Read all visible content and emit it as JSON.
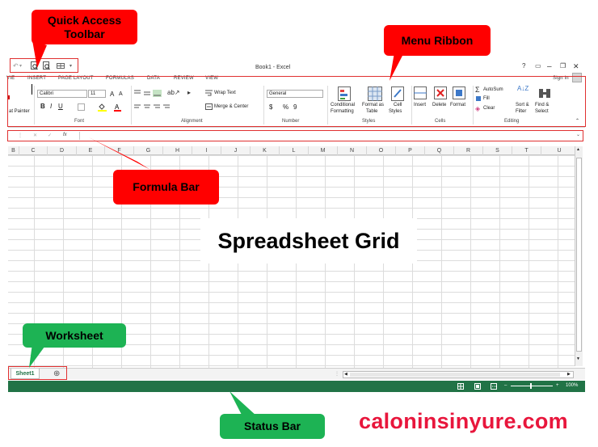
{
  "window": {
    "title": "Book1 - Excel",
    "help": "?",
    "restore_icon": "▭",
    "minimize": "–",
    "maximize": "❐",
    "close": "✕",
    "sign_in": "Sign in"
  },
  "quick_access": {
    "undo": "↶",
    "dropdown": "▾"
  },
  "tabs": [
    "VIE",
    "INSERT",
    "PAGE LAYOUT",
    "FORMULAS",
    "DATA",
    "REVIEW",
    "VIEW"
  ],
  "ribbon": {
    "clipboard": {
      "format_painter": "at Painter"
    },
    "font": {
      "name": "Calibri",
      "size": "11",
      "bold": "B",
      "italic": "I",
      "underline": "U",
      "grow": "A",
      "shrink": "A",
      "label": "Font"
    },
    "alignment": {
      "wrap_text": "Wrap Text",
      "merge_center": "Merge & Center",
      "label": "Alignment"
    },
    "number": {
      "format": "General",
      "currency": "$",
      "percent": "%",
      "comma": "9",
      "label": "Number"
    },
    "styles": {
      "conditional": "Conditional",
      "conditional2": "Formatting",
      "format_as": "Format as",
      "table": "Table",
      "cell": "Cell",
      "cell_styles": "Styles",
      "label": "Styles"
    },
    "cells": {
      "insert": "Insert",
      "delete": "Delete",
      "format": "Format",
      "label": "Cells"
    },
    "editing": {
      "autosum": "AutoSum",
      "fill": "Fill",
      "clear": "Clear",
      "sort": "Sort &",
      "filter": "Filter",
      "find": "Find &",
      "select": "Select",
      "label": "Editing"
    }
  },
  "formula_bar": {
    "dots": "⋮",
    "cancel": "✕",
    "enter": "✓",
    "fx": "fx",
    "expand": "⌄"
  },
  "columns": [
    "B",
    "C",
    "D",
    "E",
    "F",
    "G",
    "H",
    "I",
    "J",
    "K",
    "L",
    "M",
    "N",
    "O",
    "P",
    "Q",
    "R",
    "S",
    "T",
    "U"
  ],
  "sheets": {
    "sheet1": "Sheet1",
    "add": "⊕"
  },
  "status": {
    "zoom": "100%",
    "minus": "–",
    "plus": "+"
  },
  "callouts": {
    "quick_access": "Quick Access Toolbar",
    "menu_ribbon": "Menu Ribbon",
    "formula_bar": "Formula Bar",
    "spreadsheet_grid": "Spreadsheet Grid",
    "worksheet": "Worksheet",
    "status_bar": "Status Bar"
  },
  "watermark": "caloninsinyure.com",
  "colors": {
    "excel_green": "#217346",
    "callout_red": "#ff0000",
    "callout_green": "#1db354",
    "watermark": "#e8163c"
  }
}
